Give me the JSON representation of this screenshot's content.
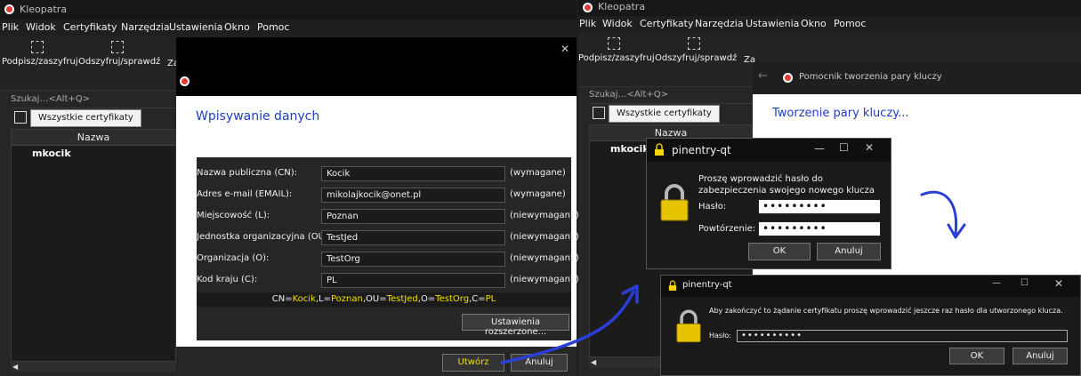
{
  "app": {
    "title": "Kleopatra",
    "menu": [
      "Plik",
      "Widok",
      "Certyfikaty",
      "Narzędzia",
      "Ustawienia",
      "Okno",
      "Pomoc"
    ],
    "toolbar": {
      "sign_encrypt": "Podpisz/zaszyfruj",
      "decrypt_verify": "Odszyfruj/sprawdź",
      "truncated": "Za"
    },
    "search_placeholder": "Szukaj…<Alt+Q>",
    "tab_all_certs": "Wszystkie certyfikaty",
    "column_name": "Nazwa",
    "rows": [
      "mkocik"
    ]
  },
  "left_dialog": {
    "heading": "Wpisywanie danych",
    "fields": [
      {
        "label": "Nazwa publiczna (CN):",
        "value": "Kocik",
        "req": "(wymagane)"
      },
      {
        "label": "Adres e-mail (EMAIL):",
        "value": "mikolajkocik@onet.pl",
        "req": "(wymagane)"
      },
      {
        "label": "Miejscowość (L):",
        "value": "Poznan",
        "req": "(niewymagany)"
      },
      {
        "label": "Jednostka organizacyjna (OU):",
        "value": "TestJed",
        "req": "(niewymagany)"
      },
      {
        "label": "Organizacja (O):",
        "value": "TestOrg",
        "req": "(niewymagany)"
      },
      {
        "label": "Kod kraju (C):",
        "value": "PL",
        "req": "(niewymagany)"
      }
    ],
    "dn": {
      "k_cn": "CN=",
      "v_cn": "Kocik",
      "k_l": ",L=",
      "v_l": "Poznan",
      "k_ou": ",OU=",
      "v_ou": "TestJed",
      "k_o": ",O=",
      "v_o": "TestOrg",
      "k_c": ",C=",
      "v_c": "PL"
    },
    "advanced_button": "Ustawienia rozszerzone...",
    "create_button": "Utwórz",
    "cancel_button": "Anuluj",
    "close_glyph": "✕"
  },
  "right_dialog": {
    "window_title": "Pomocnik tworzenia pary kluczy",
    "heading": "Tworzenie pary kluczy..."
  },
  "pinentry1": {
    "title": "pinentry-qt",
    "message": "Proszę wprowadzić hasło do\nzabezpieczenia swojego nowego klucza",
    "label_pass": "Hasło:",
    "label_repeat": "Powtórzenie:",
    "pass_dots": "•••••••••",
    "repeat_dots": "•••••••••",
    "ok": "OK",
    "cancel": "Anuluj"
  },
  "pinentry2": {
    "title": "pinentry-qt",
    "message": "Aby zakończyć to żądanie certyfikatu proszę wprowadzić jeszcze raz hasło dla utworzonego klucza.",
    "label_pass": "Hasło:",
    "pass_dots": "••••••••••",
    "ok": "OK",
    "cancel": "Anuluj"
  },
  "colors": {
    "accent_blue": "#1f3fbf",
    "dn_yellow": "#f0e000",
    "annotation_blue": "#2a3fd6"
  }
}
